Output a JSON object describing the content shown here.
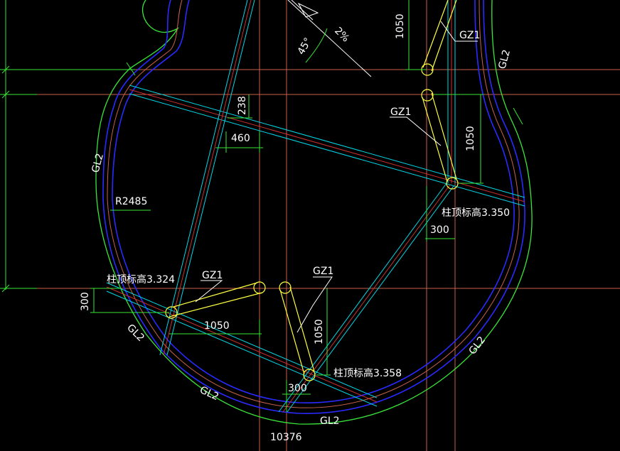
{
  "labels": {
    "gz1_top_right": "GZ1",
    "gz1_right": "GZ1",
    "gz1_left": "GZ1",
    "gz1_mid": "GZ1",
    "gl2_right_top": "GL2",
    "gl2_left": "GL2",
    "gl2_lower_left": "GL2",
    "gl2_bottom_left": "GL2",
    "gl2_bottom": "GL2",
    "gl2_right_bottom": "GL2"
  },
  "dimensions": {
    "d1050_top": "1050",
    "d238": "238",
    "d460": "460",
    "d1050_right": "1050",
    "d300_right": "300",
    "d300_left": "300",
    "d1050_left": "1050",
    "d1050_mid": "1050",
    "d300_bottom": "300",
    "d10376": "10376",
    "radius": "R2485",
    "angle45": "45°",
    "angle2": "2%"
  },
  "elevations": {
    "right": "柱顶标高3.350",
    "left": "柱顶标高3.324",
    "bottom": "柱顶标高3.358"
  },
  "colors": {
    "background": "#000000",
    "grid": "#c8604a",
    "outline_green": "#39e639",
    "outline_blue": "#2a2aff",
    "beam_cyan": "#00d8e8",
    "beam_red": "#c83030",
    "column_yellow": "#ffff40",
    "text": "#ffffff"
  }
}
